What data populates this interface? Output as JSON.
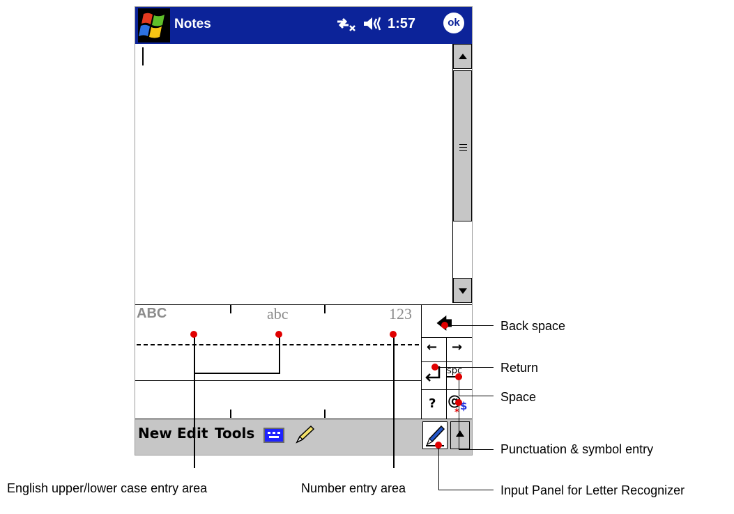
{
  "titlebar": {
    "app_title": "Notes",
    "clock": "1:57",
    "ok_label": "ok"
  },
  "recognizer": {
    "upper_label": "ABC",
    "lower_label": "abc",
    "number_label": "123"
  },
  "keypad": {
    "backspace": "🡄",
    "left": "←",
    "right": "→",
    "space_label": "spc",
    "help": "?",
    "symbol": "@"
  },
  "menubar": {
    "new_label": "New",
    "edit_label": "Edit",
    "tools_label": "Tools"
  },
  "callouts": {
    "back_space": "Back space",
    "return": "Return",
    "space": "Space",
    "punctuation": "Punctuation & symbol entry",
    "input_panel": "Input Panel for Letter Recognizer",
    "upper_lower": "English upper/lower case entry area",
    "number_area": "Number entry area"
  },
  "icons": [
    "windows-start-icon",
    "connectivity-icon",
    "speaker-icon",
    "keyboard-icon",
    "pen-icon",
    "letter-recognizer-icon",
    "scroll-up-arrow-icon",
    "scroll-down-arrow-icon"
  ],
  "colors": {
    "titlebar": "#0c2399",
    "menubar": "#c6c6c6",
    "callout_dot": "#e00000",
    "mode_label": "#8c8c8c"
  }
}
